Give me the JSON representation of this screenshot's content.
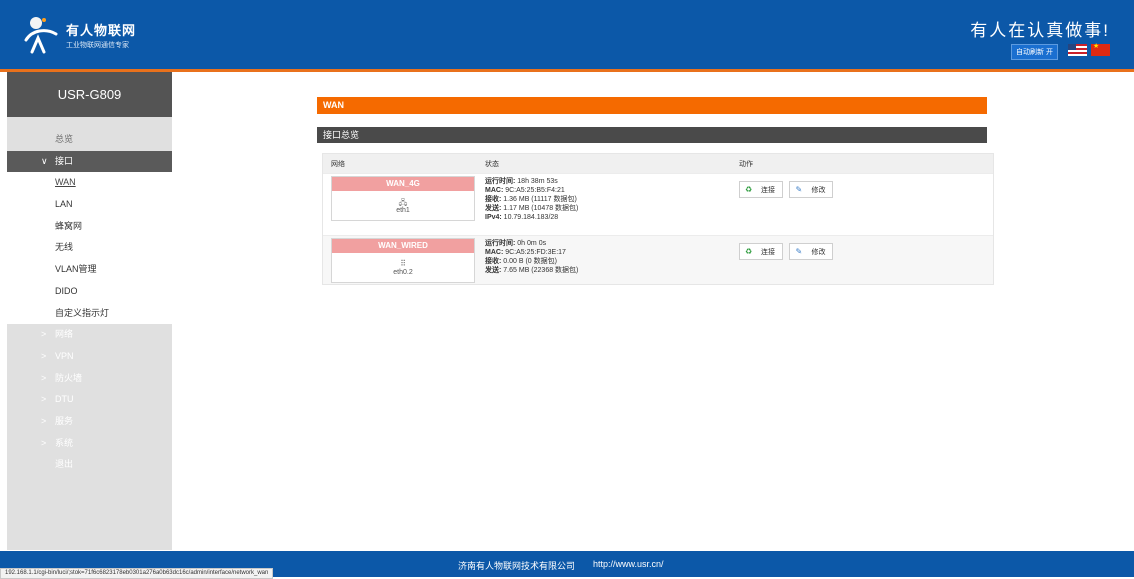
{
  "header": {
    "brand_name": "有人物联网",
    "brand_sub": "工业物联网通信专家",
    "slogan": "有人在认真做事!",
    "auto_refresh": "自动刷新 开",
    "logo_icon": "usr-person-logo-icon",
    "flags": [
      "us-flag-icon",
      "cn-flag-icon"
    ],
    "colors": {
      "bar": "#0c58a8",
      "accent": "#e9711c"
    }
  },
  "sidebar": {
    "device": "USR-G809",
    "items": [
      {
        "label": "总览",
        "kind": "top"
      },
      {
        "label": "接口",
        "kind": "open"
      },
      {
        "label": "WAN",
        "kind": "sub-active"
      },
      {
        "label": "LAN",
        "kind": "sub"
      },
      {
        "label": "蜂窝网",
        "kind": "sub"
      },
      {
        "label": "无线",
        "kind": "sub"
      },
      {
        "label": "VLAN管理",
        "kind": "sub"
      },
      {
        "label": "DIDO",
        "kind": "sub"
      },
      {
        "label": "自定义指示灯",
        "kind": "sub"
      },
      {
        "label": "网络",
        "kind": "collapsed"
      },
      {
        "label": "VPN",
        "kind": "collapsed"
      },
      {
        "label": "防火墙",
        "kind": "collapsed"
      },
      {
        "label": "DTU",
        "kind": "collapsed"
      },
      {
        "label": "服务",
        "kind": "collapsed"
      },
      {
        "label": "系统",
        "kind": "collapsed"
      },
      {
        "label": "退出",
        "kind": "top"
      }
    ]
  },
  "main": {
    "title": "WAN",
    "section": "接口总览",
    "columns": {
      "network": "网络",
      "status": "状态",
      "action": "动作"
    },
    "interfaces": [
      {
        "name": "WAN_4G",
        "device": "eth1",
        "status_lines": [
          {
            "key": "运行时间:",
            "value": " 18h 38m 53s"
          },
          {
            "key": "MAC:",
            "value": " 9C:A5:25:B5:F4:21"
          },
          {
            "key": "接收:",
            "value": " 1.36 MB (11117 数据包)"
          },
          {
            "key": "发送:",
            "value": " 1.17 MB (10478 数据包)"
          },
          {
            "key": "IPv4:",
            "value": " 10.79.184.183/28"
          }
        ],
        "connect_label": "连接",
        "edit_label": "修改"
      },
      {
        "name": "WAN_WIRED",
        "device": "eth0.2",
        "status_lines": [
          {
            "key": "运行时间:",
            "value": " 0h 0m 0s"
          },
          {
            "key": "MAC:",
            "value": " 9C:A5:25:FD:3E:17"
          },
          {
            "key": "接收:",
            "value": " 0.00 B (0 数据包)"
          },
          {
            "key": "发送:",
            "value": " 7.65 MB (22368 数据包)"
          }
        ],
        "connect_label": "连接",
        "edit_label": "修改"
      }
    ]
  },
  "footer": {
    "company": "济南有人物联网技术有限公司",
    "url": "http://www.usr.cn/"
  },
  "browser_status": "192.168.1.1/cgi-bin/luci/;stok=71f6c6823178eb0301a276a0b63dc16c/admin/interface/network_wan"
}
